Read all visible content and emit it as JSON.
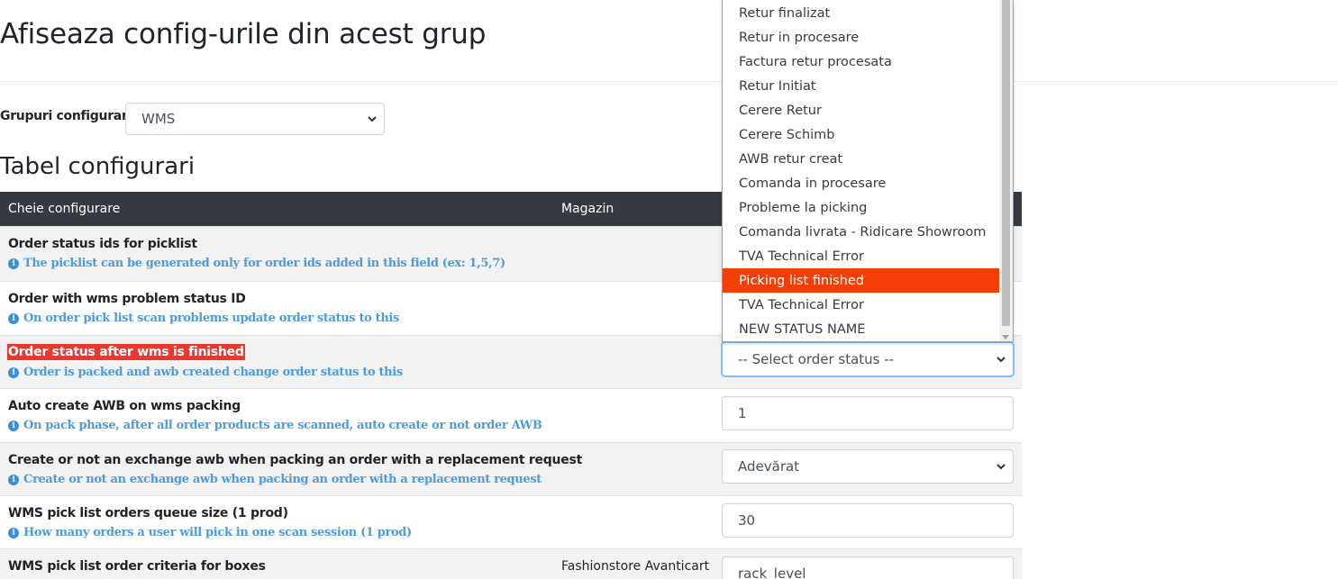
{
  "page": {
    "title": "Afiseaza config-urile din acest grup",
    "group_label": "Grupuri configurare",
    "group_value": "WMS",
    "section_title": "Tabel configurari"
  },
  "table": {
    "columns": [
      "Cheie configurare",
      "Magazin"
    ],
    "rows": [
      {
        "title": "Order status ids for picklist",
        "help": "The picklist can be generated only for order ids added in this field (ex: 1,5,7)",
        "shop": "",
        "value": ""
      },
      {
        "title": "Order with wms problem status ID",
        "help": "On order pick list scan problems update order status to this",
        "shop": "",
        "value": ""
      },
      {
        "title": "Order status after wms is finished",
        "help": "Order is packed and awb created change order status to this",
        "shop": "",
        "value": "-- Select order status --"
      },
      {
        "title": "Auto create AWB on wms packing",
        "help": "On pack phase, after all order products are scanned, auto create or not order AWB",
        "shop": "",
        "value": "1"
      },
      {
        "title": "Create or not an exchange awb when packing an order with a replacement request",
        "help": "Create or not an exchange awb when packing an order with a replacement request",
        "shop": "",
        "value": "Adevărat"
      },
      {
        "title": "WMS pick list orders queue size (1 prod)",
        "help": "How many orders a user will pick in one scan session (1 prod)",
        "shop": "",
        "value": "30"
      },
      {
        "title": "WMS pick list order criteria for boxes",
        "help": "",
        "shop": "Fashionstore Avanticart",
        "value": "rack_level"
      }
    ]
  },
  "dropdown": {
    "options": [
      "Retur finalizat",
      "Retur in procesare",
      "Factura retur procesata",
      "Retur Initiat",
      "Cerere Retur",
      "Cerere Schimb",
      "AWB retur creat",
      "Comanda in procesare",
      "Probleme la picking",
      "Comanda livrata - Ridicare Showroom",
      "TVA Technical Error",
      "Picking list finished",
      "TVA Technical Error",
      "NEW STATUS NAME"
    ],
    "selected_index": 11,
    "highlight_color": "#f33e04"
  },
  "colors": {
    "header_bg": "#343a40",
    "help_text": "#4e9bdc",
    "highlight_bg": "#e8382f"
  },
  "icons": {
    "info": "info-circle-icon",
    "caret": "chevron-down-icon"
  }
}
